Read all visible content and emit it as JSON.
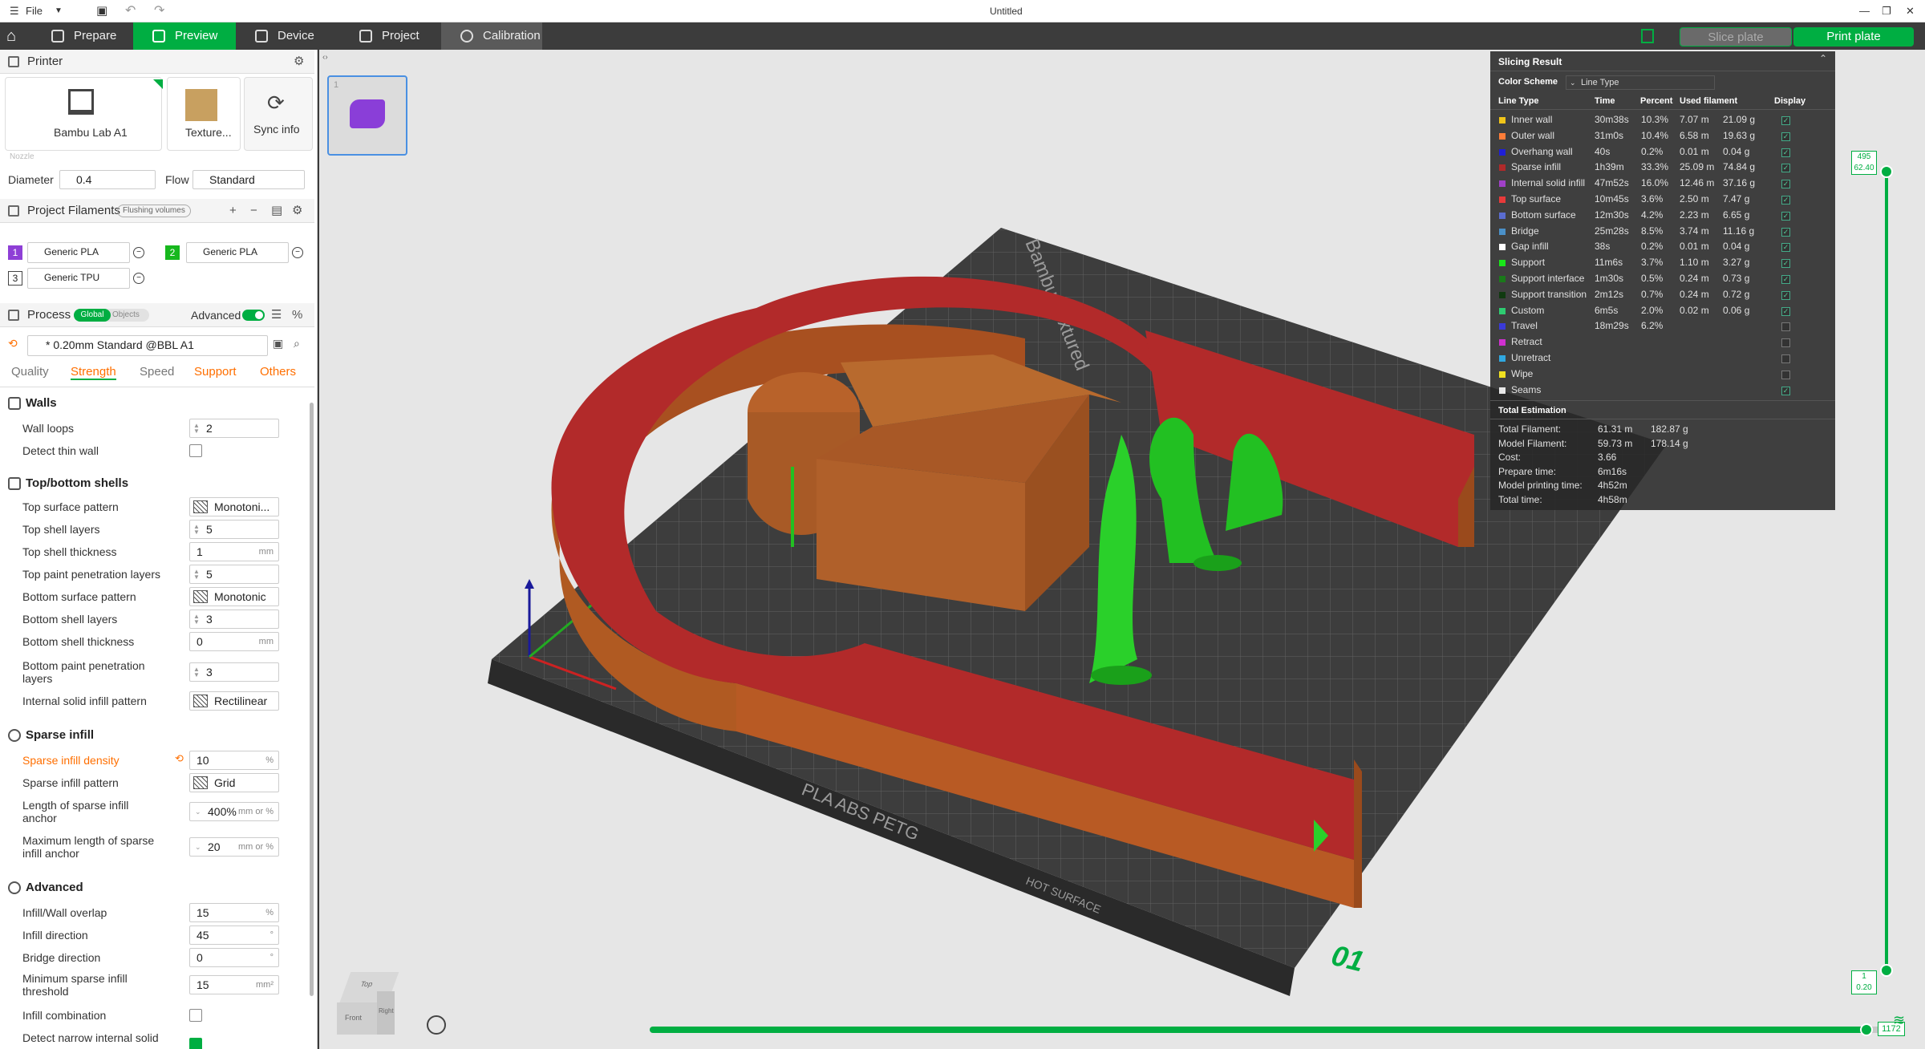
{
  "titlebar": {
    "file_label": "File",
    "window_title": "Untitled"
  },
  "tabs": [
    {
      "label": "Prepare"
    },
    {
      "label": "Preview"
    },
    {
      "label": "Device"
    },
    {
      "label": "Project"
    },
    {
      "label": "Calibration"
    }
  ],
  "actions": {
    "slice_label": "Slice plate",
    "print_label": "Print plate"
  },
  "printer": {
    "section_label": "Printer",
    "name": "Bambu Lab A1",
    "plate": "Texture...",
    "sync_label": "Sync info",
    "nozzle_label": "Nozzle",
    "diameter_label": "Diameter",
    "diameter_value": "0.4",
    "flow_label": "Flow",
    "flow_value": "Standard"
  },
  "filaments": {
    "section_label": "Project Filaments",
    "flush_label": "Flushing volumes",
    "items": [
      {
        "index": "1",
        "name": "Generic PLA",
        "color": "#8e3fd6"
      },
      {
        "index": "2",
        "name": "Generic PLA",
        "color": "#17b81e"
      },
      {
        "index": "3",
        "name": "Generic TPU",
        "color": "#ffffff"
      }
    ]
  },
  "process": {
    "section_label": "Process",
    "global_label": "Global",
    "objects_label": "Objects",
    "advanced_label": "Advanced",
    "preset": "* 0.20mm Standard @BBL A1",
    "subtabs": [
      "Quality",
      "Strength",
      "Speed",
      "Support",
      "Others"
    ]
  },
  "settings": {
    "walls": {
      "title": "Walls",
      "wall_loops_label": "Wall loops",
      "wall_loops": "2",
      "detect_thin_label": "Detect thin wall"
    },
    "shells": {
      "title": "Top/bottom shells",
      "top_pattern_label": "Top surface pattern",
      "top_pattern": "Monotoni...",
      "top_layers_label": "Top shell layers",
      "top_layers": "5",
      "top_thick_label": "Top shell thickness",
      "top_thick": "1",
      "unit_mm": "mm",
      "top_paint_label": "Top paint penetration layers",
      "top_paint": "5",
      "bottom_pattern_label": "Bottom surface pattern",
      "bottom_pattern": "Monotonic",
      "bottom_layers_label": "Bottom shell layers",
      "bottom_layers": "3",
      "bottom_thick_label": "Bottom shell thickness",
      "bottom_thick": "0",
      "bottom_paint_label": "Bottom paint penetration layers",
      "bottom_paint": "3",
      "internal_pattern_label": "Internal solid infill pattern",
      "internal_pattern": "Rectilinear"
    },
    "sparse": {
      "title": "Sparse infill",
      "density_label": "Sparse infill density",
      "density": "10",
      "unit_pct": "%",
      "pattern_label": "Sparse infill pattern",
      "pattern": "Grid",
      "anchor_label": "Length of sparse infill anchor",
      "anchor": "400%",
      "anchor_unit": "mm or %",
      "max_anchor_label": "Maximum length of sparse infill anchor",
      "max_anchor": "20"
    },
    "advanced": {
      "title": "Advanced",
      "overlap_label": "Infill/Wall overlap",
      "overlap": "15",
      "direction_label": "Infill direction",
      "direction": "45",
      "unit_deg": "°",
      "bridge_label": "Bridge direction",
      "bridge": "0",
      "min_sparse_label": "Minimum sparse infill threshold",
      "min_sparse": "15",
      "unit_mm2": "mm²",
      "combination_label": "Infill combination",
      "narrow_label": "Detect narrow internal solid"
    }
  },
  "result": {
    "title": "Slicing Result",
    "scheme_label": "Color Scheme",
    "scheme_value": "Line Type",
    "columns": [
      "Line Type",
      "Time",
      "Percent",
      "Used filament",
      "Display"
    ],
    "rows": [
      {
        "name": "Inner wall",
        "color": "#f0c419",
        "time": "30m38s",
        "pct": "10.3%",
        "m": "7.07 m",
        "g": "21.09 g",
        "on": true
      },
      {
        "name": "Outer wall",
        "color": "#ff7d38",
        "time": "31m0s",
        "pct": "10.4%",
        "m": "6.58 m",
        "g": "19.63 g",
        "on": true
      },
      {
        "name": "Overhang wall",
        "color": "#1f1fd6",
        "time": "40s",
        "pct": "0.2%",
        "m": "0.01 m",
        "g": "0.04 g",
        "on": true
      },
      {
        "name": "Sparse infill",
        "color": "#b02a2a",
        "time": "1h39m",
        "pct": "33.3%",
        "m": "25.09 m",
        "g": "74.84 g",
        "on": true
      },
      {
        "name": "Internal solid infill",
        "color": "#a040c8",
        "time": "47m52s",
        "pct": "16.0%",
        "m": "12.46 m",
        "g": "37.16 g",
        "on": true
      },
      {
        "name": "Top surface",
        "color": "#e83a3a",
        "time": "10m45s",
        "pct": "3.6%",
        "m": "2.50 m",
        "g": "7.47 g",
        "on": true
      },
      {
        "name": "Bottom surface",
        "color": "#5a6cd0",
        "time": "12m30s",
        "pct": "4.2%",
        "m": "2.23 m",
        "g": "6.65 g",
        "on": true
      },
      {
        "name": "Bridge",
        "color": "#4a90c8",
        "time": "25m28s",
        "pct": "8.5%",
        "m": "3.74 m",
        "g": "11.16 g",
        "on": true
      },
      {
        "name": "Gap infill",
        "color": "#ffffff",
        "time": "38s",
        "pct": "0.2%",
        "m": "0.01 m",
        "g": "0.04 g",
        "on": true
      },
      {
        "name": "Support",
        "color": "#19e619",
        "time": "11m6s",
        "pct": "3.7%",
        "m": "1.10 m",
        "g": "3.27 g",
        "on": true
      },
      {
        "name": "Support interface",
        "color": "#1a7a1a",
        "time": "1m30s",
        "pct": "0.5%",
        "m": "0.24 m",
        "g": "0.73 g",
        "on": true
      },
      {
        "name": "Support transition",
        "color": "#103a10",
        "time": "2m12s",
        "pct": "0.7%",
        "m": "0.24 m",
        "g": "0.72 g",
        "on": true
      },
      {
        "name": "Custom",
        "color": "#2ecc71",
        "time": "6m5s",
        "pct": "2.0%",
        "m": "0.02 m",
        "g": "0.06 g",
        "on": true
      },
      {
        "name": "Travel",
        "color": "#3a3ad8",
        "time": "18m29s",
        "pct": "6.2%",
        "m": "",
        "g": "",
        "on": false
      },
      {
        "name": "Retract",
        "color": "#d030d0",
        "time": "",
        "pct": "",
        "m": "",
        "g": "",
        "on": false
      },
      {
        "name": "Unretract",
        "color": "#30a8e0",
        "time": "",
        "pct": "",
        "m": "",
        "g": "",
        "on": false
      },
      {
        "name": "Wipe",
        "color": "#f0e020",
        "time": "",
        "pct": "",
        "m": "",
        "g": "",
        "on": false
      },
      {
        "name": "Seams",
        "color": "#e8e8e8",
        "time": "",
        "pct": "",
        "m": "",
        "g": "",
        "on": true
      }
    ],
    "total_title": "Total Estimation",
    "totals": [
      {
        "label": "Total Filament:",
        "v1": "61.31 m",
        "v2": "182.87 g"
      },
      {
        "label": "Model Filament:",
        "v1": "59.73 m",
        "v2": "178.14 g"
      },
      {
        "label": "Cost:",
        "v1": "3.66",
        "v2": ""
      },
      {
        "label": "Prepare time:",
        "v1": "6m16s",
        "v2": ""
      },
      {
        "label": "Model printing time:",
        "v1": "4h52m",
        "v2": ""
      },
      {
        "label": "Total time:",
        "v1": "4h58m",
        "v2": ""
      }
    ]
  },
  "layer_slider": {
    "top_layer": "495",
    "top_height": "62.40",
    "bottom_layer": "1",
    "bottom_height": "0.20"
  },
  "move_slider": {
    "value": "1172"
  },
  "plate": {
    "number": "1",
    "bed_label_1": "Bambu Textured",
    "bed_label_2": "PLA ABS PETG",
    "bed_label_3": "HOT SURFACE",
    "plate_number": "01"
  },
  "viewcube": {
    "top": "Top",
    "front": "Front",
    "right": "Right"
  }
}
